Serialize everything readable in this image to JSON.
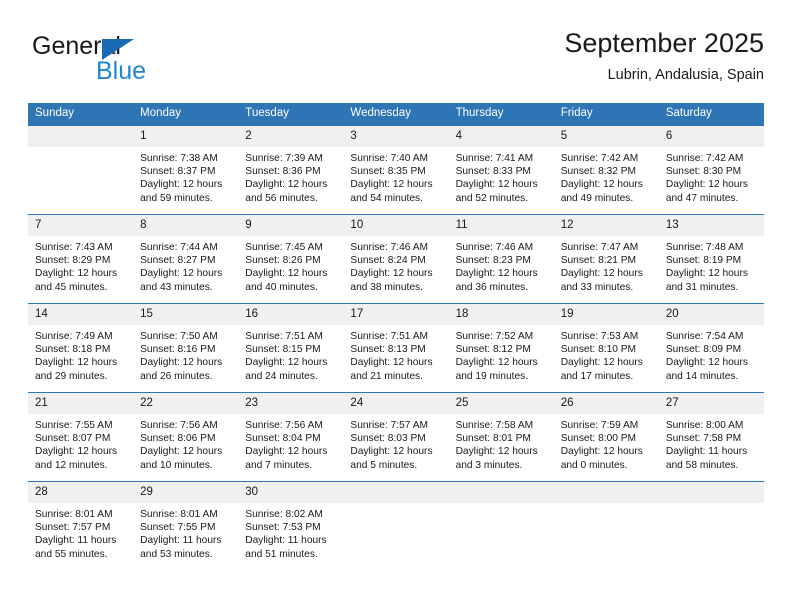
{
  "brand": {
    "name_top": "General",
    "name_bottom": "Blue",
    "logo_icon": "triangle-logo-icon",
    "color_top": "#1a1a1a",
    "color_bottom": "#2185d0",
    "triangle_color": "#1a69b4"
  },
  "header": {
    "title": "September 2025",
    "subtitle": "Lubrin, Andalusia, Spain"
  },
  "theme": {
    "header_bg": "#2e75b6",
    "header_text": "#ffffff",
    "daynum_bg": "#f0f0f0",
    "grid_line": "#2e75b6",
    "body_text": "#1a1a1a"
  },
  "weekdays": [
    "Sunday",
    "Monday",
    "Tuesday",
    "Wednesday",
    "Thursday",
    "Friday",
    "Saturday"
  ],
  "weeks": [
    [
      {
        "day": "",
        "empty": true,
        "sunrise": "",
        "sunset": "",
        "daylight_line1": "",
        "daylight_line2": ""
      },
      {
        "day": "1",
        "sunrise": "Sunrise: 7:38 AM",
        "sunset": "Sunset: 8:37 PM",
        "daylight_line1": "Daylight: 12 hours",
        "daylight_line2": "and 59 minutes."
      },
      {
        "day": "2",
        "sunrise": "Sunrise: 7:39 AM",
        "sunset": "Sunset: 8:36 PM",
        "daylight_line1": "Daylight: 12 hours",
        "daylight_line2": "and 56 minutes."
      },
      {
        "day": "3",
        "sunrise": "Sunrise: 7:40 AM",
        "sunset": "Sunset: 8:35 PM",
        "daylight_line1": "Daylight: 12 hours",
        "daylight_line2": "and 54 minutes."
      },
      {
        "day": "4",
        "sunrise": "Sunrise: 7:41 AM",
        "sunset": "Sunset: 8:33 PM",
        "daylight_line1": "Daylight: 12 hours",
        "daylight_line2": "and 52 minutes."
      },
      {
        "day": "5",
        "sunrise": "Sunrise: 7:42 AM",
        "sunset": "Sunset: 8:32 PM",
        "daylight_line1": "Daylight: 12 hours",
        "daylight_line2": "and 49 minutes."
      },
      {
        "day": "6",
        "sunrise": "Sunrise: 7:42 AM",
        "sunset": "Sunset: 8:30 PM",
        "daylight_line1": "Daylight: 12 hours",
        "daylight_line2": "and 47 minutes."
      }
    ],
    [
      {
        "day": "7",
        "sunrise": "Sunrise: 7:43 AM",
        "sunset": "Sunset: 8:29 PM",
        "daylight_line1": "Daylight: 12 hours",
        "daylight_line2": "and 45 minutes."
      },
      {
        "day": "8",
        "sunrise": "Sunrise: 7:44 AM",
        "sunset": "Sunset: 8:27 PM",
        "daylight_line1": "Daylight: 12 hours",
        "daylight_line2": "and 43 minutes."
      },
      {
        "day": "9",
        "sunrise": "Sunrise: 7:45 AM",
        "sunset": "Sunset: 8:26 PM",
        "daylight_line1": "Daylight: 12 hours",
        "daylight_line2": "and 40 minutes."
      },
      {
        "day": "10",
        "sunrise": "Sunrise: 7:46 AM",
        "sunset": "Sunset: 8:24 PM",
        "daylight_line1": "Daylight: 12 hours",
        "daylight_line2": "and 38 minutes."
      },
      {
        "day": "11",
        "sunrise": "Sunrise: 7:46 AM",
        "sunset": "Sunset: 8:23 PM",
        "daylight_line1": "Daylight: 12 hours",
        "daylight_line2": "and 36 minutes."
      },
      {
        "day": "12",
        "sunrise": "Sunrise: 7:47 AM",
        "sunset": "Sunset: 8:21 PM",
        "daylight_line1": "Daylight: 12 hours",
        "daylight_line2": "and 33 minutes."
      },
      {
        "day": "13",
        "sunrise": "Sunrise: 7:48 AM",
        "sunset": "Sunset: 8:19 PM",
        "daylight_line1": "Daylight: 12 hours",
        "daylight_line2": "and 31 minutes."
      }
    ],
    [
      {
        "day": "14",
        "sunrise": "Sunrise: 7:49 AM",
        "sunset": "Sunset: 8:18 PM",
        "daylight_line1": "Daylight: 12 hours",
        "daylight_line2": "and 29 minutes."
      },
      {
        "day": "15",
        "sunrise": "Sunrise: 7:50 AM",
        "sunset": "Sunset: 8:16 PM",
        "daylight_line1": "Daylight: 12 hours",
        "daylight_line2": "and 26 minutes."
      },
      {
        "day": "16",
        "sunrise": "Sunrise: 7:51 AM",
        "sunset": "Sunset: 8:15 PM",
        "daylight_line1": "Daylight: 12 hours",
        "daylight_line2": "and 24 minutes."
      },
      {
        "day": "17",
        "sunrise": "Sunrise: 7:51 AM",
        "sunset": "Sunset: 8:13 PM",
        "daylight_line1": "Daylight: 12 hours",
        "daylight_line2": "and 21 minutes."
      },
      {
        "day": "18",
        "sunrise": "Sunrise: 7:52 AM",
        "sunset": "Sunset: 8:12 PM",
        "daylight_line1": "Daylight: 12 hours",
        "daylight_line2": "and 19 minutes."
      },
      {
        "day": "19",
        "sunrise": "Sunrise: 7:53 AM",
        "sunset": "Sunset: 8:10 PM",
        "daylight_line1": "Daylight: 12 hours",
        "daylight_line2": "and 17 minutes."
      },
      {
        "day": "20",
        "sunrise": "Sunrise: 7:54 AM",
        "sunset": "Sunset: 8:09 PM",
        "daylight_line1": "Daylight: 12 hours",
        "daylight_line2": "and 14 minutes."
      }
    ],
    [
      {
        "day": "21",
        "sunrise": "Sunrise: 7:55 AM",
        "sunset": "Sunset: 8:07 PM",
        "daylight_line1": "Daylight: 12 hours",
        "daylight_line2": "and 12 minutes."
      },
      {
        "day": "22",
        "sunrise": "Sunrise: 7:56 AM",
        "sunset": "Sunset: 8:06 PM",
        "daylight_line1": "Daylight: 12 hours",
        "daylight_line2": "and 10 minutes."
      },
      {
        "day": "23",
        "sunrise": "Sunrise: 7:56 AM",
        "sunset": "Sunset: 8:04 PM",
        "daylight_line1": "Daylight: 12 hours",
        "daylight_line2": "and 7 minutes."
      },
      {
        "day": "24",
        "sunrise": "Sunrise: 7:57 AM",
        "sunset": "Sunset: 8:03 PM",
        "daylight_line1": "Daylight: 12 hours",
        "daylight_line2": "and 5 minutes."
      },
      {
        "day": "25",
        "sunrise": "Sunrise: 7:58 AM",
        "sunset": "Sunset: 8:01 PM",
        "daylight_line1": "Daylight: 12 hours",
        "daylight_line2": "and 3 minutes."
      },
      {
        "day": "26",
        "sunrise": "Sunrise: 7:59 AM",
        "sunset": "Sunset: 8:00 PM",
        "daylight_line1": "Daylight: 12 hours",
        "daylight_line2": "and 0 minutes."
      },
      {
        "day": "27",
        "sunrise": "Sunrise: 8:00 AM",
        "sunset": "Sunset: 7:58 PM",
        "daylight_line1": "Daylight: 11 hours",
        "daylight_line2": "and 58 minutes."
      }
    ],
    [
      {
        "day": "28",
        "sunrise": "Sunrise: 8:01 AM",
        "sunset": "Sunset: 7:57 PM",
        "daylight_line1": "Daylight: 11 hours",
        "daylight_line2": "and 55 minutes."
      },
      {
        "day": "29",
        "sunrise": "Sunrise: 8:01 AM",
        "sunset": "Sunset: 7:55 PM",
        "daylight_line1": "Daylight: 11 hours",
        "daylight_line2": "and 53 minutes."
      },
      {
        "day": "30",
        "sunrise": "Sunrise: 8:02 AM",
        "sunset": "Sunset: 7:53 PM",
        "daylight_line1": "Daylight: 11 hours",
        "daylight_line2": "and 51 minutes."
      },
      {
        "day": "",
        "empty": true,
        "sunrise": "",
        "sunset": "",
        "daylight_line1": "",
        "daylight_line2": ""
      },
      {
        "day": "",
        "empty": true,
        "sunrise": "",
        "sunset": "",
        "daylight_line1": "",
        "daylight_line2": ""
      },
      {
        "day": "",
        "empty": true,
        "sunrise": "",
        "sunset": "",
        "daylight_line1": "",
        "daylight_line2": ""
      },
      {
        "day": "",
        "empty": true,
        "sunrise": "",
        "sunset": "",
        "daylight_line1": "",
        "daylight_line2": ""
      }
    ]
  ]
}
